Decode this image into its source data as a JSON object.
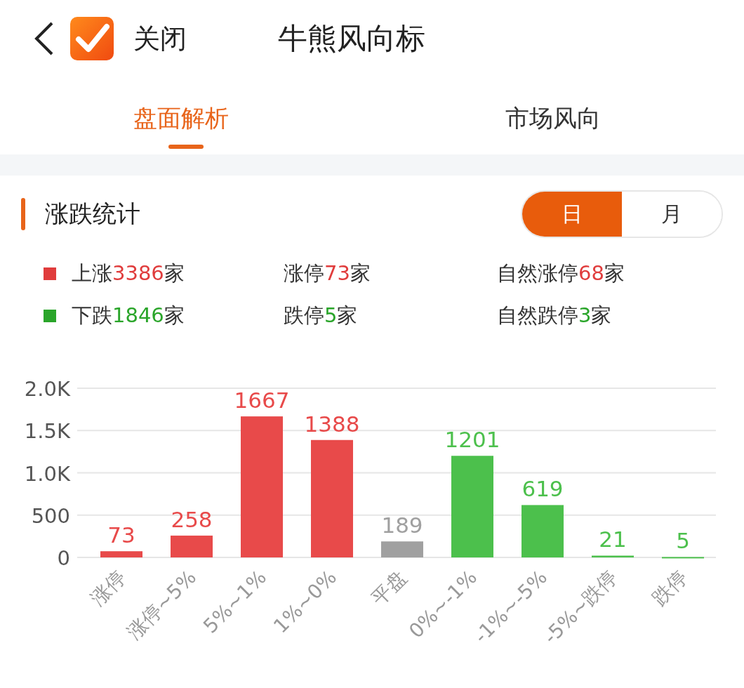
{
  "header": {
    "close_label": "关闭",
    "title": "牛熊风向标"
  },
  "tabs": [
    {
      "label": "盘面解析",
      "selected": true
    },
    {
      "label": "市场风向",
      "selected": false
    }
  ],
  "section": {
    "title": "涨跌统计",
    "periods": [
      {
        "label": "日",
        "selected": true
      },
      {
        "label": "月",
        "selected": false
      }
    ],
    "stats": [
      {
        "label": "上涨",
        "count": "3386",
        "unit": "家",
        "color": "#e03c3c",
        "marker": true
      },
      {
        "label": "涨停",
        "count": "73",
        "unit": "家",
        "color": "#e03c3c",
        "marker": false
      },
      {
        "label": "自然涨停",
        "count": "68",
        "unit": "家",
        "color": "#e03c3c",
        "marker": false
      },
      {
        "label": "下跌",
        "count": "1846",
        "unit": "家",
        "color": "#2aa52a",
        "marker": true
      },
      {
        "label": "跌停",
        "count": "5",
        "unit": "家",
        "color": "#2aa52a",
        "marker": false
      },
      {
        "label": "自然跌停",
        "count": "3",
        "unit": "家",
        "color": "#2aa52a",
        "marker": false
      }
    ],
    "chart_data": {
      "type": "bar",
      "categories": [
        "涨停",
        "涨停~5%",
        "5%~1%",
        "1%~0%",
        "平盘",
        "0%~-1%",
        "-1%~-5%",
        "-5%~跌停",
        "跌停"
      ],
      "values": [
        73,
        258,
        1667,
        1388,
        189,
        1201,
        619,
        21,
        5
      ],
      "colors": [
        "#e84a4a",
        "#e84a4a",
        "#e84a4a",
        "#e84a4a",
        "#a0a0a0",
        "#4cc04c",
        "#4cc04c",
        "#4cc04c",
        "#4cc04c"
      ],
      "grid": true,
      "ylim": [
        0,
        2000
      ],
      "yticks": [
        {
          "value": 0,
          "label": "0"
        },
        {
          "value": 500,
          "label": "500"
        },
        {
          "value": 1000,
          "label": "1.0K"
        },
        {
          "value": 1500,
          "label": "1.5K"
        },
        {
          "value": 2000,
          "label": "2.0K"
        }
      ],
      "data_labels": true
    }
  }
}
